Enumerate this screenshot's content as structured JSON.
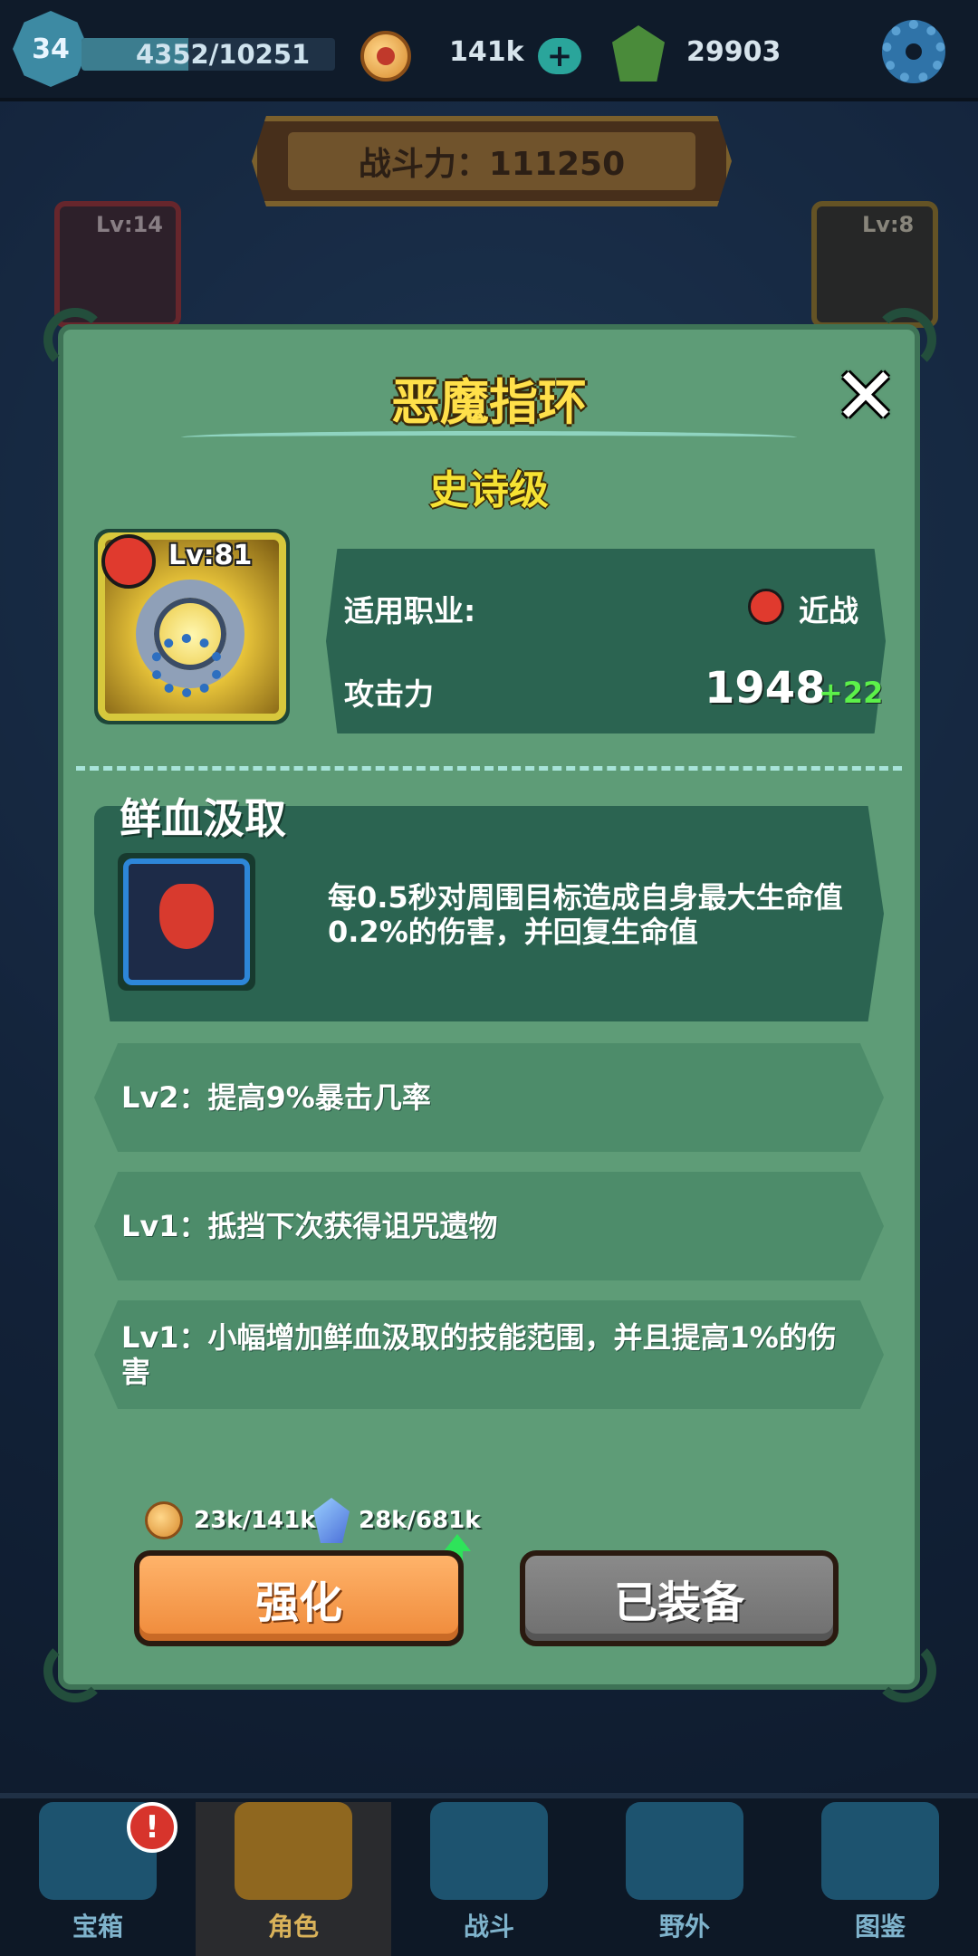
{
  "topbar": {
    "level": "34",
    "xp_text": "4352/10251",
    "xp_progress": 0.42,
    "coins": "141k",
    "gems": "29903"
  },
  "power_banner": "战斗力：111250",
  "background_slots": {
    "left_level": "Lv:14",
    "right_level": "Lv:8"
  },
  "item": {
    "name": "恶魔指环",
    "rarity": "史诗级",
    "level": "Lv:81",
    "class_label": "适用职业:",
    "class_value": "近战",
    "attack_label": "攻击力",
    "attack_value": "1948",
    "attack_bonus": "+22"
  },
  "skill": {
    "name": "鲜血汲取",
    "description": "每0.5秒对周围目标造成自身最大生命值0.2%的伤害，并回复生命值"
  },
  "perks": [
    {
      "text": "Lv2：提高9%暴击几率"
    },
    {
      "text": "Lv1：抵挡下次获得诅咒遗物"
    },
    {
      "text": "Lv1：小幅增加鲜血汲取的技能范围，并且提高1%的伤害"
    }
  ],
  "costs": {
    "coin_cost": "23k/141k",
    "crystal_cost": "28k/681k"
  },
  "buttons": {
    "upgrade": "强化",
    "equipped": "已装备"
  },
  "bottom_nav": [
    {
      "label": "宝箱",
      "badge": "!"
    },
    {
      "label": "角色"
    },
    {
      "label": "战斗"
    },
    {
      "label": "野外"
    },
    {
      "label": "图鉴"
    }
  ],
  "colors": {
    "modal_bg": "#5e9c77",
    "title_yellow": "#ffe04a",
    "bonus_green": "#5cf04a",
    "upgrade_orange": "#ef8a3a"
  }
}
